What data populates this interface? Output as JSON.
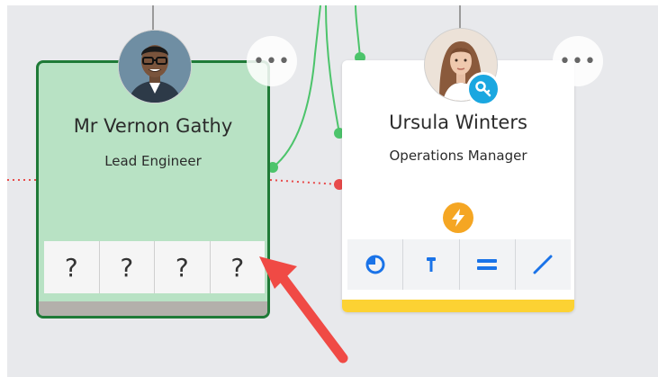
{
  "cards": [
    {
      "name": "Mr Vernon Gathy",
      "role": "Lead Engineer",
      "slots": [
        "?",
        "?",
        "?",
        "?"
      ],
      "more_label": "•••"
    },
    {
      "name": "Ursula Winters",
      "role": "Operations Manager",
      "skill_icons": [
        "circle-arc-icon",
        "hammer-icon",
        "equals-icon",
        "slash-icon"
      ],
      "badge_icons": [
        "key-icon",
        "lightning-bolt-icon"
      ],
      "more_label": "•••"
    }
  ],
  "colors": {
    "canvas": "#e8e9ec",
    "selected_card_fill": "#b8e2c4",
    "selected_card_border": "#1f7a37",
    "connector_green": "#4cc46b",
    "connector_red": "#e84b4b",
    "accent_blue": "#1a73e8",
    "key_badge": "#1aa7e0",
    "bolt_badge": "#f5a623",
    "bottom_bar_yellow": "#fcd233",
    "arrow_red": "#f04a45"
  }
}
